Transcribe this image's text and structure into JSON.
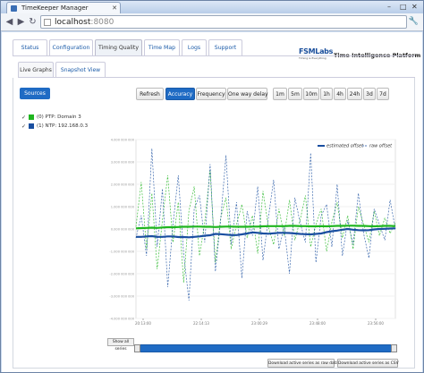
{
  "browser": {
    "tab_title": "TimeKeeper Manager",
    "url_host": "localhost",
    "url_port": ":8080"
  },
  "header": {
    "logo_text": "FSMLabs",
    "logo_sub": "Timing is Everything",
    "platform": "Time Intelligence Platform"
  },
  "main_tabs": [
    "Status",
    "Configuration",
    "Timing Quality",
    "Time Map",
    "Logs",
    "Support"
  ],
  "active_main_tab": "Timing Quality",
  "sub_tabs": [
    "Live Graphs",
    "Snapshot View"
  ],
  "active_sub_tab": "Live Graphs",
  "sources_button": "Sources",
  "sources": [
    {
      "label": "(0) PTP: Domain 3",
      "color": "#1fb51f"
    },
    {
      "label": "(1) NTP: 192.168.0.3",
      "color": "#1a4fa0"
    }
  ],
  "toolbar": {
    "refresh": "Refresh",
    "metrics": [
      "Accuracy",
      "Frequency",
      "One way delay"
    ],
    "active_metric": "Accuracy",
    "ranges": [
      "1m",
      "5m",
      "10m",
      "1h",
      "4h",
      "24h",
      "3d",
      "7d"
    ]
  },
  "chart_data": {
    "type": "line",
    "legend": [
      "estimated offset",
      "raw offset"
    ],
    "legend_position": "top-right",
    "x_ticks": [
      "20:13:00",
      "22:14:13",
      "23:00:29",
      "23:48:00",
      "23:56:00"
    ],
    "y_ticks": [
      "4.000 000 000",
      "3.000 000 000",
      "2.000 000 000",
      "1.000 000 000",
      "0.000 000 000",
      "-1.000 000 000",
      "-2.000 000 000",
      "-3.000 000 000",
      "-4.000 000 000"
    ],
    "ylim": [
      -4,
      4
    ],
    "series": [
      {
        "name": "(0) PTP: Domain 3",
        "kind": "estimated offset",
        "color": "#1fb51f",
        "values": [
          0.03,
          0.04,
          0.05,
          0.06,
          0.05,
          0.07,
          0.08,
          0.08,
          0.09,
          0.1,
          0.1,
          0.11,
          0.11,
          0.1,
          0.1,
          0.09,
          0.1,
          0.11,
          0.11,
          0.1,
          0.1,
          0.1,
          0.11,
          0.11,
          0.12,
          0.13,
          0.13,
          0.13,
          0.13,
          0.14,
          0.14,
          0.13,
          0.13,
          0.12,
          0.12,
          0.13,
          0.12,
          0.13,
          0.14,
          0.14,
          0.15,
          0.15,
          0.14,
          0.14,
          0.13,
          0.12,
          0.13,
          0.14,
          0.14,
          0.13
        ]
      },
      {
        "name": "(1) NTP: 192.168.0.3",
        "kind": "estimated offset",
        "color": "#1a4fa0",
        "values": [
          -0.35,
          -0.35,
          -0.33,
          -0.32,
          -0.35,
          -0.35,
          -0.33,
          -0.33,
          -0.36,
          -0.36,
          -0.37,
          -0.35,
          -0.33,
          -0.3,
          -0.28,
          -0.22,
          -0.23,
          -0.25,
          -0.27,
          -0.27,
          -0.24,
          -0.2,
          -0.15,
          -0.17,
          -0.2,
          -0.21,
          -0.19,
          -0.17,
          -0.17,
          -0.18,
          -0.2,
          -0.22,
          -0.23,
          -0.24,
          -0.22,
          -0.2,
          -0.14,
          -0.1,
          -0.07,
          -0.03,
          0.0,
          -0.03,
          -0.05,
          -0.06,
          -0.05,
          -0.02,
          0.0,
          0.01,
          0.02,
          0.03
        ]
      },
      {
        "name": "(0) PTP: Domain 3",
        "kind": "raw offset",
        "color": "#1fb51f",
        "values": [
          0.1,
          2.1,
          -0.9,
          1.6,
          -1.8,
          0.4,
          2.4,
          -0.6,
          1.2,
          -2.4,
          0.8,
          1.9,
          -1.2,
          0.3,
          2.6,
          -1.5,
          0.5,
          1.4,
          -0.9,
          0.2,
          1.1,
          -0.4,
          0.6,
          -1.1,
          1.7,
          0.1,
          -0.7,
          0.9,
          -0.3,
          1.3,
          -0.5,
          0.4,
          1.5,
          -0.8,
          0.2,
          0.9,
          -1.0,
          0.3,
          1.2,
          -0.4,
          0.6,
          -0.9,
          1.0,
          0.2,
          -0.6,
          0.8,
          -0.3,
          0.5,
          -0.2,
          0.3
        ]
      },
      {
        "name": "(1) NTP: 192.168.0.3",
        "kind": "raw offset",
        "color": "#1a4fa0",
        "values": [
          -0.4,
          0.6,
          -1.2,
          3.6,
          -0.8,
          1.8,
          -2.6,
          0.2,
          2.4,
          -1.1,
          -3.2,
          0.9,
          1.5,
          -0.6,
          2.9,
          -1.9,
          0.4,
          3.3,
          -0.7,
          1.2,
          -2.2,
          0.8,
          -0.3,
          1.9,
          -1.4,
          0.5,
          2.2,
          -0.9,
          0.1,
          -2.0,
          1.4,
          0.3,
          -0.6,
          3.4,
          -1.5,
          0.6,
          1.1,
          -0.8,
          2.0,
          -1.2,
          0.4,
          -0.7,
          1.6,
          -0.2,
          -1.3,
          0.9,
          0.2,
          -0.5,
          1.3,
          0.0
        ]
      }
    ]
  },
  "range_slider": {
    "start": 0.0,
    "end": 1.0
  },
  "show_all_button": "Show all series",
  "download_buttons": [
    "Download active series as raw data",
    "Download active series as CSV"
  ],
  "colors": {
    "accent": "#1f6bc4",
    "ptp": "#1fb51f",
    "ntp": "#1a4fa0"
  }
}
